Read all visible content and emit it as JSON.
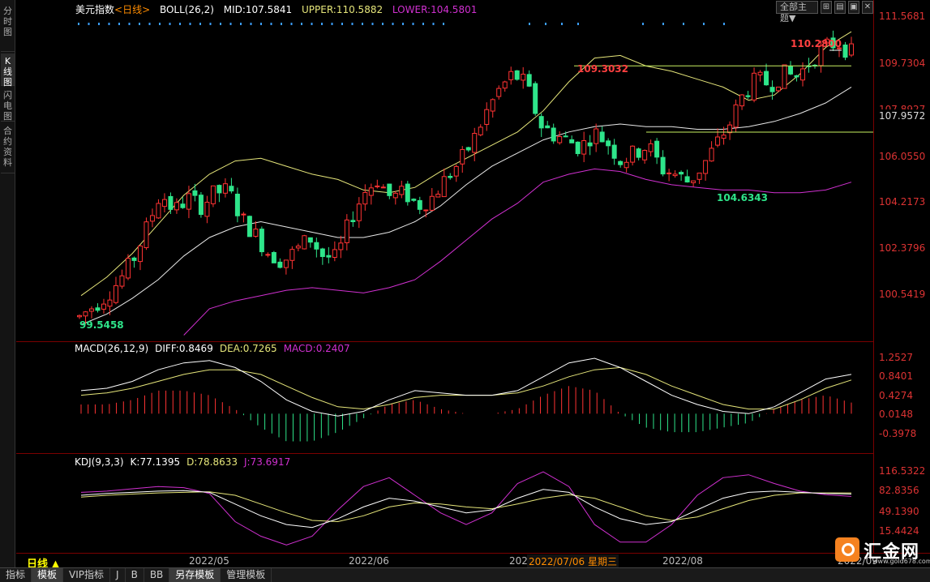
{
  "side_tabs": [
    "分时图",
    "K线图",
    "闪电图",
    "合约资料"
  ],
  "active_side_tab": 1,
  "main": {
    "title": "美元指数",
    "period_tag": "<日线>",
    "boll": {
      "label": "BOLL(26,2)",
      "mid": "MID:107.5841",
      "upper": "UPPER:110.5882",
      "lower": "LOWER:104.5801"
    },
    "annotations": {
      "high": "110.2800",
      "peak1": "109.3032",
      "low": "104.6343",
      "start_low": "99.5458"
    }
  },
  "topctl": {
    "theme": "全部主题▼",
    "icons": [
      "⊞",
      "▤",
      "▣",
      "✕"
    ]
  },
  "axis": {
    "main_ticks": [
      "111.5681",
      "109.7304",
      "107.8927",
      "106.0550",
      "104.2173",
      "102.3796",
      "100.5419"
    ],
    "current_price": "107.9572",
    "macd_ticks": [
      "1.2527",
      "0.8401",
      "0.4274",
      "0.0148",
      "-0.3978"
    ],
    "kdj_ticks": [
      "116.5322",
      "82.8356",
      "49.1390",
      "15.4424"
    ]
  },
  "macd": {
    "label": "MACD(26,12,9)",
    "diff": "DIFF:0.8469",
    "dea": "DEA:0.7265",
    "macd": "MACD:0.2407"
  },
  "kdj": {
    "label": "KDJ(9,3,3)",
    "k": "K:77.1395",
    "d": "D:78.8633",
    "j": "J:73.6917"
  },
  "date_axis": {
    "period": "日线 ▲",
    "labels": [
      "2022/05",
      "2022/06",
      "202",
      "2022/08",
      "2022/09"
    ],
    "crosshair": "2022/07/06 星期三"
  },
  "toolbar": [
    "指标",
    "模板",
    "VIP指标",
    "J",
    "B",
    "BB",
    "另存模板",
    "管理模板"
  ],
  "toolbar_selected": [
    1,
    6
  ],
  "logo": {
    "name": "汇金网",
    "url": "www.gold678.com"
  },
  "colors": {
    "up": "#ff3333",
    "down": "#2ee58a",
    "upper_band": "#e6e67a",
    "mid_band": "#e8e8e8",
    "lower_band": "#d030d0",
    "dea": "#e6e67a",
    "diff": "#ffffff",
    "k": "#ffffff",
    "d": "#e6e67a",
    "j": "#d030d0",
    "hline": "#c8f060"
  },
  "chart_data": {
    "type": "candlestick",
    "instrument": "美元指数",
    "x_range": [
      "2022/04",
      "2022/09"
    ],
    "ylim": [
      98.9,
      111.8
    ],
    "yticks": [
      111.5681,
      109.7304,
      107.8927,
      106.055,
      104.2173,
      102.3796,
      100.5419
    ],
    "key_points": {
      "start_low": 99.5458,
      "peak1": 109.3032,
      "trough": 104.6343,
      "high": 110.28,
      "last": 107.9572
    },
    "ohlc_path": [
      99.8,
      100.2,
      100.6,
      101.2,
      102.0,
      103.2,
      104.5,
      103.8,
      104.3,
      104.0,
      104.5,
      104.6,
      103.5,
      102.9,
      102.2,
      101.9,
      102.3,
      102.8,
      102.1,
      102.0,
      103.5,
      104.5,
      105.0,
      104.3,
      104.5,
      104.0,
      104.3,
      105.0,
      105.6,
      106.4,
      107.5,
      108.4,
      109.0,
      108.6,
      107.1,
      106.7,
      106.5,
      106.2,
      106.8,
      106.4,
      105.7,
      106.0,
      106.3,
      105.4,
      105.2,
      104.9,
      105.5,
      106.3,
      107.1,
      108.2,
      108.8,
      108.6,
      109.0,
      108.9,
      109.5,
      110.0,
      110.2,
      109.8
    ],
    "boll": {
      "upper": [
        100.6,
        101.3,
        102.2,
        103.3,
        104.4,
        105.2,
        105.7,
        105.8,
        105.5,
        105.2,
        105.0,
        104.6,
        104.5,
        104.7,
        105.3,
        105.8,
        106.3,
        106.8,
        107.6,
        108.7,
        109.6,
        109.7,
        109.3,
        109.1,
        108.8,
        108.5,
        108.0,
        108.2,
        109.0,
        110.0,
        110.6
      ],
      "mid": [
        99.5,
        99.9,
        100.5,
        101.2,
        102.1,
        102.8,
        103.2,
        103.4,
        103.2,
        103.0,
        102.8,
        102.8,
        103.0,
        103.4,
        104.0,
        104.8,
        105.5,
        106.0,
        106.5,
        106.8,
        107.0,
        107.1,
        107.0,
        107.0,
        106.9,
        106.9,
        107.0,
        107.2,
        107.5,
        107.9,
        108.5
      ],
      "lower": [
        null,
        null,
        null,
        null,
        99.1,
        100.1,
        100.4,
        100.6,
        100.8,
        100.9,
        100.8,
        100.7,
        100.9,
        101.2,
        101.9,
        102.7,
        103.5,
        104.1,
        104.9,
        105.2,
        105.4,
        105.3,
        105.0,
        104.8,
        104.7,
        104.6,
        104.6,
        104.5,
        104.5,
        104.6,
        104.9
      ]
    },
    "macd_series": {
      "diff": [
        0.5,
        0.55,
        0.7,
        0.95,
        1.1,
        1.15,
        1.0,
        0.7,
        0.3,
        0.05,
        -0.05,
        0.05,
        0.3,
        0.5,
        0.45,
        0.4,
        0.4,
        0.5,
        0.8,
        1.1,
        1.2,
        1.0,
        0.7,
        0.4,
        0.2,
        0.05,
        0.0,
        0.15,
        0.45,
        0.75,
        0.85
      ],
      "dea": [
        0.4,
        0.45,
        0.55,
        0.7,
        0.85,
        0.95,
        0.95,
        0.85,
        0.6,
        0.35,
        0.15,
        0.1,
        0.2,
        0.35,
        0.4,
        0.4,
        0.4,
        0.45,
        0.6,
        0.8,
        0.95,
        1.0,
        0.85,
        0.6,
        0.4,
        0.2,
        0.1,
        0.1,
        0.3,
        0.55,
        0.73
      ]
    },
    "kdj_series": {
      "k": [
        75,
        78,
        80,
        82,
        83,
        80,
        60,
        40,
        25,
        20,
        35,
        55,
        70,
        65,
        55,
        45,
        50,
        70,
        85,
        80,
        55,
        35,
        25,
        30,
        50,
        70,
        80,
        82,
        80,
        78,
        77
      ],
      "d": [
        72,
        75,
        77,
        79,
        80,
        81,
        75,
        60,
        45,
        32,
        30,
        40,
        55,
        62,
        60,
        55,
        52,
        60,
        70,
        76,
        70,
        55,
        40,
        32,
        38,
        52,
        66,
        75,
        79,
        79,
        79
      ],
      "j": [
        80,
        82,
        86,
        90,
        88,
        78,
        30,
        5,
        -10,
        5,
        50,
        90,
        105,
        75,
        45,
        25,
        45,
        95,
        115,
        90,
        25,
        -5,
        -5,
        25,
        75,
        105,
        110,
        95,
        82,
        76,
        73
      ]
    }
  }
}
